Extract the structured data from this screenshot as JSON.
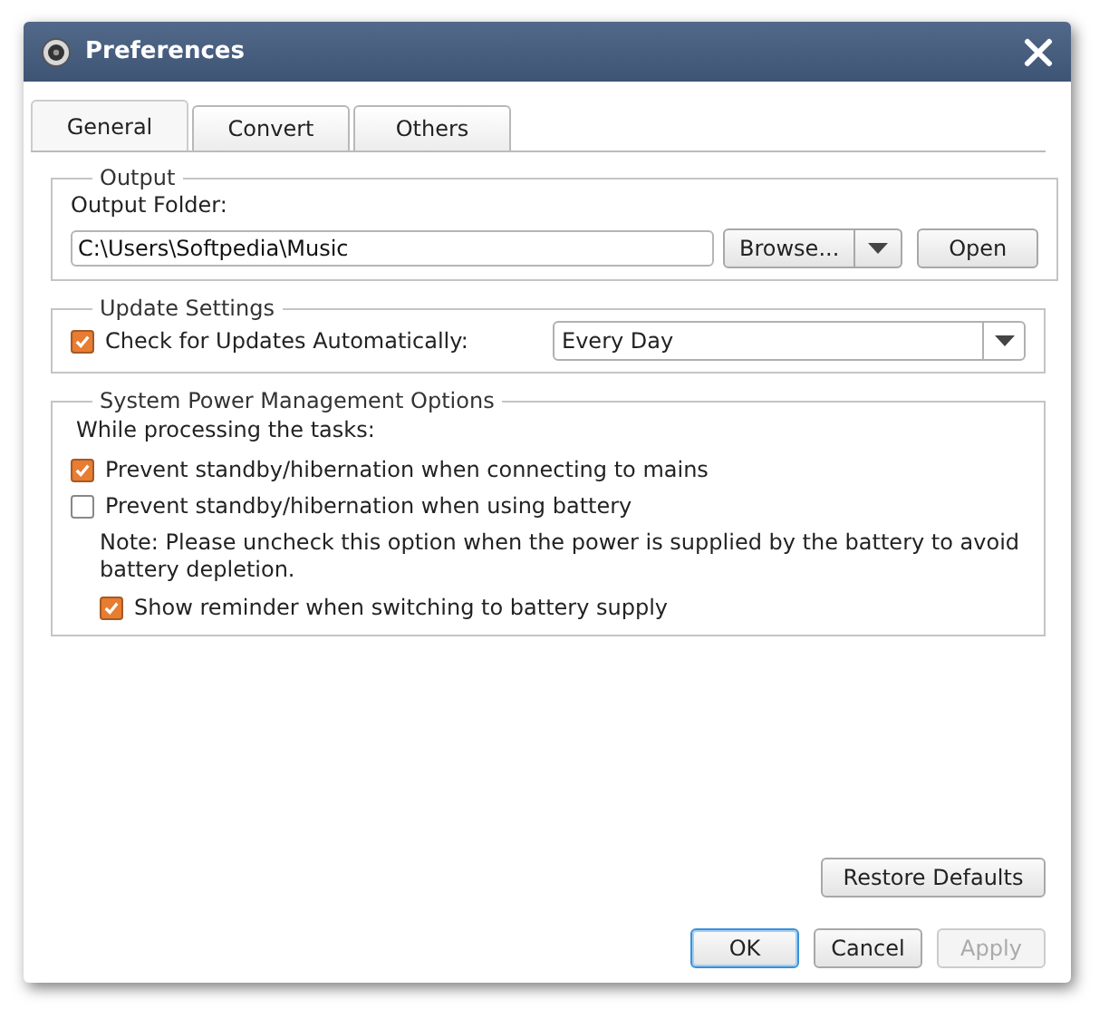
{
  "window": {
    "title": "Preferences"
  },
  "tabs": [
    {
      "label": "General",
      "selected": true
    },
    {
      "label": "Convert",
      "selected": false
    },
    {
      "label": "Others",
      "selected": false
    }
  ],
  "output": {
    "title": "Output",
    "folder_label": "Output Folder:",
    "folder_value": "C:\\Users\\Softpedia\\Music",
    "browse_button": "Browse...",
    "open_button": "Open"
  },
  "update_settings": {
    "title": "Update Settings",
    "check_label": "Check for Updates Automatically:",
    "checked": true,
    "frequency": "Every Day"
  },
  "power": {
    "title": "System Power Management Options",
    "intro": "While processing the tasks:",
    "options": [
      {
        "label": "Prevent standby/hibernation when connecting to mains",
        "checked": true
      },
      {
        "label": "Prevent standby/hibernation when using battery",
        "checked": false
      }
    ],
    "note": "Note: Please uncheck this option when the power is supplied by the battery to avoid battery depletion.",
    "reminder": {
      "label": "Show reminder when switching to battery supply",
      "checked": true
    }
  },
  "restore_button": "Restore Defaults",
  "buttons": [
    {
      "label": "OK",
      "kind": "default",
      "disabled": false
    },
    {
      "label": "Cancel",
      "kind": "normal",
      "disabled": false
    },
    {
      "label": "Apply",
      "kind": "normal",
      "disabled": true
    }
  ]
}
